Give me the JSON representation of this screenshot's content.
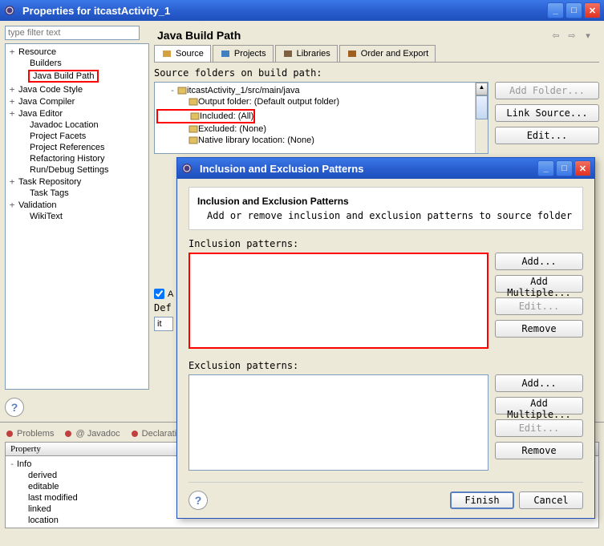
{
  "mainWindow": {
    "title": "Properties for itcastActivity_1"
  },
  "filter": {
    "placeholder": "type filter text"
  },
  "tree": {
    "items": [
      {
        "exp": "+",
        "label": "Resource",
        "indent": 0
      },
      {
        "exp": "",
        "label": "Builders",
        "indent": 1
      },
      {
        "exp": "",
        "label": "Java Build Path",
        "indent": 1,
        "selected": true
      },
      {
        "exp": "+",
        "label": "Java Code Style",
        "indent": 0
      },
      {
        "exp": "+",
        "label": "Java Compiler",
        "indent": 0
      },
      {
        "exp": "+",
        "label": "Java Editor",
        "indent": 0
      },
      {
        "exp": "",
        "label": "Javadoc Location",
        "indent": 1
      },
      {
        "exp": "",
        "label": "Project Facets",
        "indent": 1
      },
      {
        "exp": "",
        "label": "Project References",
        "indent": 1
      },
      {
        "exp": "",
        "label": "Refactoring History",
        "indent": 1
      },
      {
        "exp": "",
        "label": "Run/Debug Settings",
        "indent": 1
      },
      {
        "exp": "+",
        "label": "Task Repository",
        "indent": 0
      },
      {
        "exp": "",
        "label": "Task Tags",
        "indent": 1
      },
      {
        "exp": "+",
        "label": "Validation",
        "indent": 0
      },
      {
        "exp": "",
        "label": "WikiText",
        "indent": 1
      }
    ]
  },
  "rightPanel": {
    "title": "Java Build Path",
    "tabs": [
      "Source",
      "Projects",
      "Libraries",
      "Order and Export"
    ],
    "srcLabel": "Source folders on build path:",
    "srcTree": [
      {
        "exp": "-",
        "icon": "folder",
        "text": "itcastActivity_1/src/main/java",
        "indent": 0
      },
      {
        "exp": "",
        "icon": "out",
        "text": "Output folder: (Default output folder)",
        "indent": 1
      },
      {
        "exp": "",
        "icon": "inc",
        "text": "Included: (All)",
        "indent": 1,
        "hl": true
      },
      {
        "exp": "",
        "icon": "exc",
        "text": "Excluded: (None)",
        "indent": 1
      },
      {
        "exp": "",
        "icon": "nat",
        "text": "Native library location: (None)",
        "indent": 1
      }
    ],
    "btns": {
      "addFolder": "Add Folder...",
      "linkSource": "Link Source...",
      "edit": "Edit..."
    },
    "allowCheck": "A",
    "defLabel": "Def",
    "defValue": "it"
  },
  "modal": {
    "title": "Inclusion and Exclusion Patterns",
    "heading": "Inclusion and Exclusion Patterns",
    "desc": "Add or remove inclusion and exclusion patterns to source folder",
    "incLabel": "Inclusion patterns:",
    "excLabel": "Exclusion patterns:",
    "btns": {
      "add": "Add...",
      "addMultiple": "Add Multiple...",
      "edit": "Edit...",
      "remove": "Remove",
      "finish": "Finish",
      "cancel": "Cancel"
    }
  },
  "bottom": {
    "tabs": [
      "Problems",
      "@ Javadoc",
      "Declarati"
    ],
    "propHeader": "Property",
    "propRows": [
      {
        "exp": "-",
        "label": "Info"
      },
      {
        "exp": "",
        "label": "derived"
      },
      {
        "exp": "",
        "label": "editable"
      },
      {
        "exp": "",
        "label": "last modified"
      },
      {
        "exp": "",
        "label": "linked"
      },
      {
        "exp": "",
        "label": "location"
      }
    ]
  }
}
